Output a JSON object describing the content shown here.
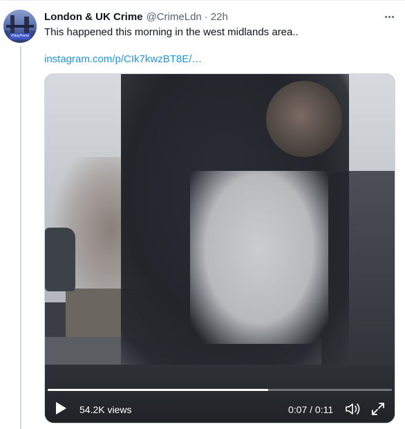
{
  "tweet": {
    "author_name": "London & UK Crime",
    "handle": "@CrimeLdn",
    "separator": "·",
    "time": "22h",
    "text": "This happened this morning in the west midlands area..",
    "link": "instagram.com/p/CIk7kwzBT8E/…",
    "avatar_badge": "#StayHome"
  },
  "video": {
    "views": "54.2K views",
    "elapsed": "0:07",
    "duration": "0:11",
    "time_display": "0:07 / 0:11",
    "progress": 0.64
  },
  "icons": {
    "more": "more-icon",
    "play": "play-icon",
    "volume": "volume-icon",
    "fullscreen": "fullscreen-icon"
  },
  "colors": {
    "link": "#1b95e0",
    "name": "#0f1419",
    "secondary": "#536471"
  }
}
